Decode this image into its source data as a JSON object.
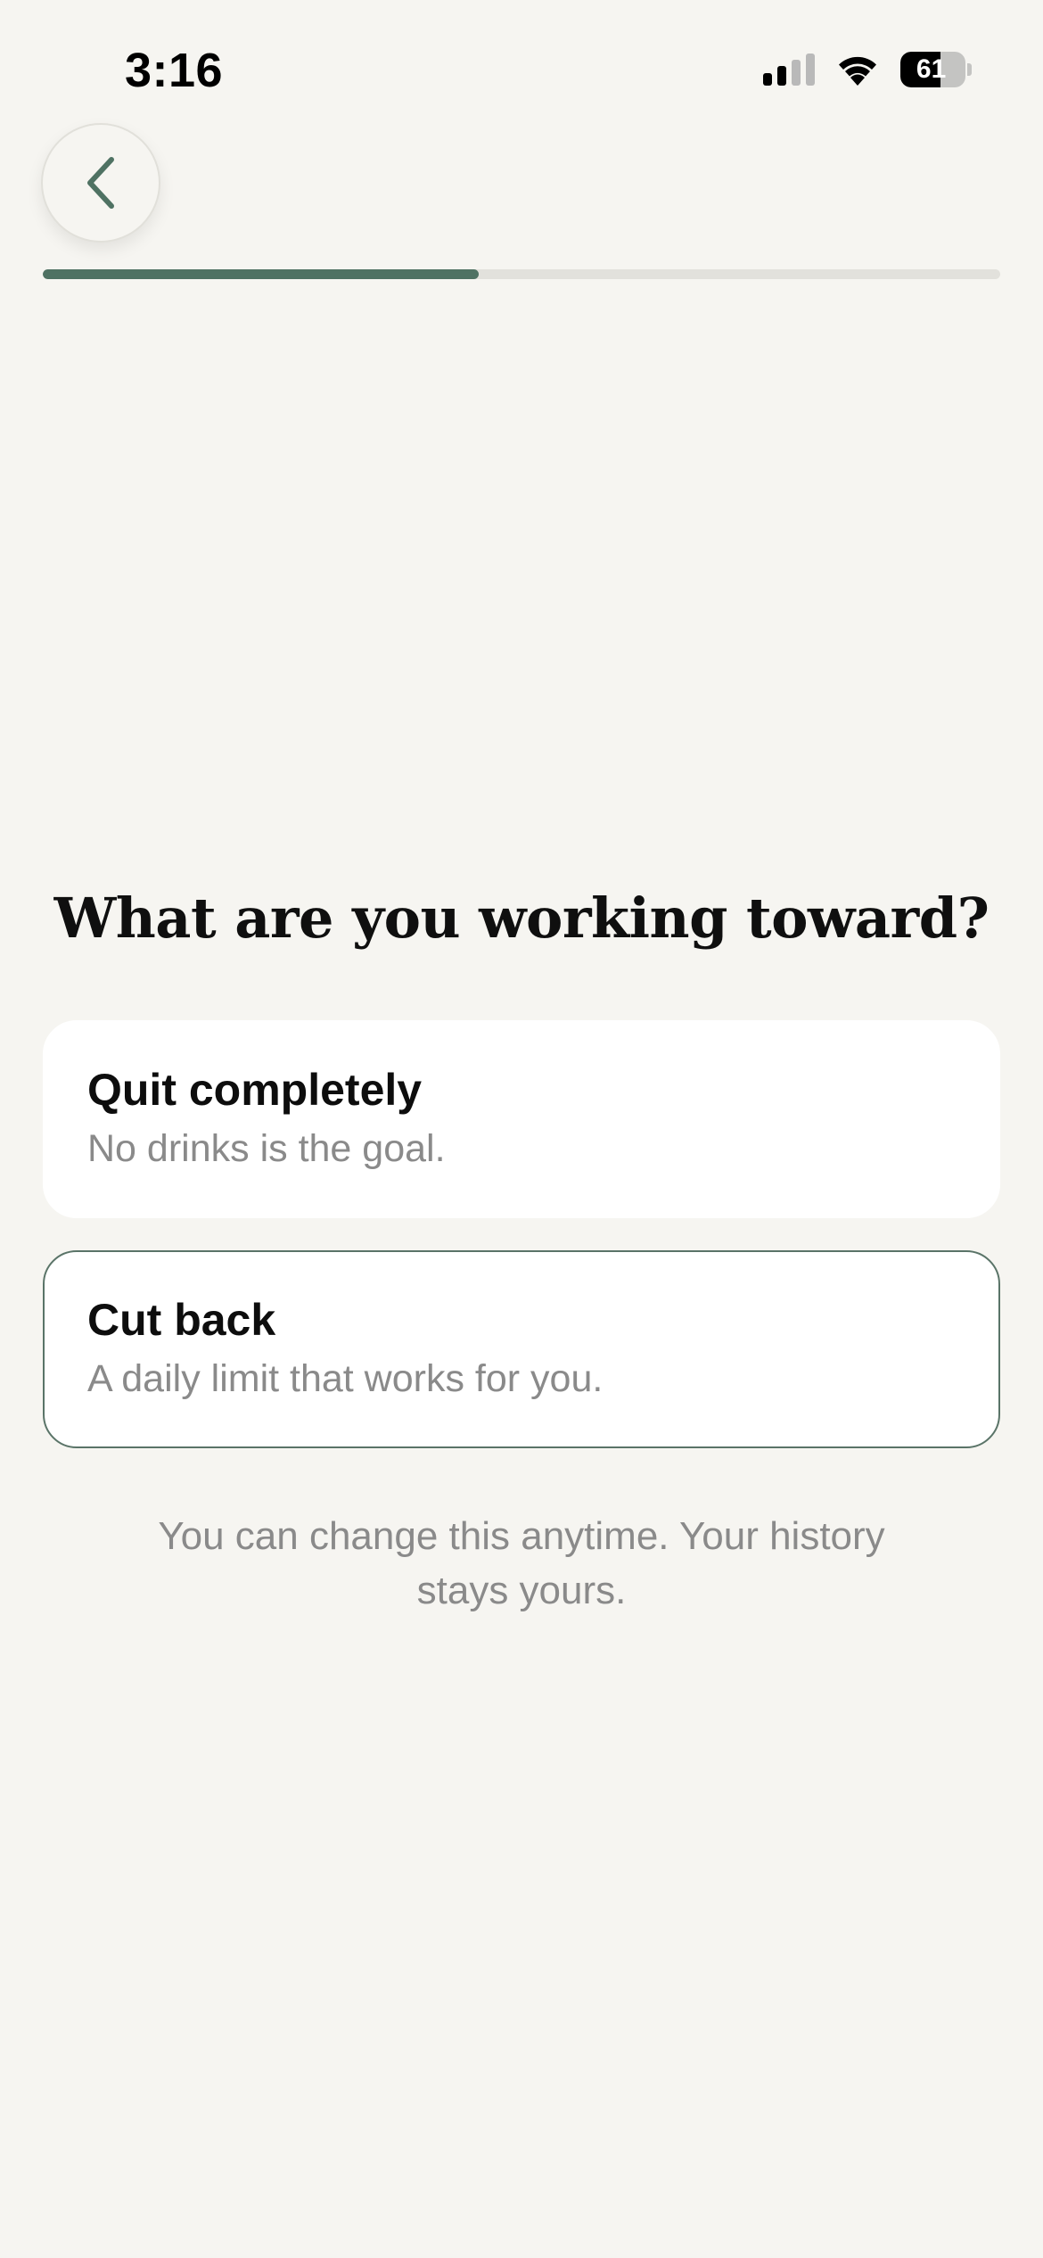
{
  "status_bar": {
    "time": "3:16",
    "battery": "61",
    "battery_level": 0.61,
    "signal_bars_active": 2,
    "signal_bars_total": 4
  },
  "nav": {
    "back_icon": "chevron-left-icon"
  },
  "progress": {
    "value": 0.455
  },
  "question": {
    "title": "What are you working toward?"
  },
  "options": [
    {
      "title": "Quit completely",
      "subtitle": "No drinks is the goal.",
      "selected": false
    },
    {
      "title": "Cut back",
      "subtitle": "A daily limit that works for you.",
      "selected": true
    }
  ],
  "footnote": "You can change this anytime. Your history stays yours.",
  "colors": {
    "background": "#f6f5f1",
    "accent": "#4f7263",
    "selected_border": "#5a7468",
    "muted_text": "#8a8a8a"
  }
}
